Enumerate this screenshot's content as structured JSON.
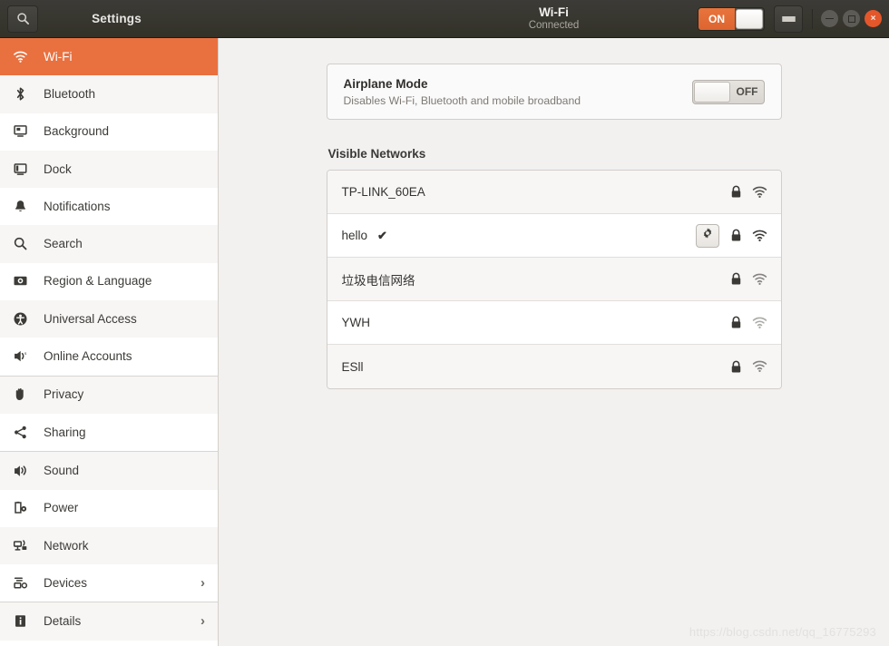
{
  "titlebar": {
    "search_icon": "search-icon",
    "app_title": "Settings",
    "page_title": "Wi-Fi",
    "page_subtitle": "Connected",
    "wifi_toggle_label": "ON",
    "menu_icon": "hamburger-menu-icon",
    "minimize_label": "",
    "maximize_label": "",
    "close_label": "×",
    "accent_color": "#e8743c",
    "bar_color": "#3c3b37"
  },
  "sidebar": {
    "items": [
      {
        "label": "Wi-Fi",
        "icon": "wifi-icon",
        "selected": true,
        "chevron": ""
      },
      {
        "label": "Bluetooth",
        "icon": "bluetooth-icon",
        "selected": false,
        "chevron": ""
      },
      {
        "label": "Background",
        "icon": "background-icon",
        "selected": false,
        "chevron": ""
      },
      {
        "label": "Dock",
        "icon": "dock-icon",
        "selected": false,
        "chevron": ""
      },
      {
        "label": "Notifications",
        "icon": "bell-icon",
        "selected": false,
        "chevron": ""
      },
      {
        "label": "Search",
        "icon": "search-icon",
        "selected": false,
        "chevron": ""
      },
      {
        "label": "Region & Language",
        "icon": "region-language-icon",
        "selected": false,
        "chevron": ""
      },
      {
        "label": "Universal Access",
        "icon": "accessibility-icon",
        "selected": false,
        "chevron": ""
      },
      {
        "label": "Online Accounts",
        "icon": "online-accounts-icon",
        "selected": false,
        "chevron": ""
      },
      {
        "label": "Privacy",
        "icon": "hand-icon",
        "selected": false,
        "chevron": ""
      },
      {
        "label": "Sharing",
        "icon": "share-icon",
        "selected": false,
        "chevron": ""
      },
      {
        "label": "Sound",
        "icon": "speaker-icon",
        "selected": false,
        "chevron": ""
      },
      {
        "label": "Power",
        "icon": "battery-icon",
        "selected": false,
        "chevron": ""
      },
      {
        "label": "Network",
        "icon": "network-icon",
        "selected": false,
        "chevron": ""
      },
      {
        "label": "Devices",
        "icon": "devices-icon",
        "selected": false,
        "chevron": "›"
      },
      {
        "label": "Details",
        "icon": "info-icon",
        "selected": false,
        "chevron": "›"
      }
    ],
    "selected_background": "#e9703f"
  },
  "main": {
    "airplane_mode": {
      "title": "Airplane Mode",
      "description": "Disables Wi-Fi, Bluetooth and mobile broadband",
      "toggle_label": "OFF",
      "toggle_state": "off"
    },
    "visible_networks_title": "Visible Networks",
    "networks": [
      {
        "ssid": "TP-LINK_60EA",
        "connected": false,
        "check": "",
        "has_settings": false,
        "secured": true,
        "signal": 3
      },
      {
        "ssid": "hello",
        "connected": true,
        "check": "✔",
        "has_settings": true,
        "secured": true,
        "signal": 4
      },
      {
        "ssid": "垃圾电信网络",
        "connected": false,
        "check": "",
        "has_settings": false,
        "secured": true,
        "signal": 2
      },
      {
        "ssid": "YWH",
        "connected": false,
        "check": "",
        "has_settings": false,
        "secured": true,
        "signal": 1
      },
      {
        "ssid": "ESll",
        "connected": false,
        "check": "",
        "has_settings": false,
        "secured": true,
        "signal": 2
      }
    ]
  },
  "watermark": "https://blog.csdn.net/qq_16775293"
}
